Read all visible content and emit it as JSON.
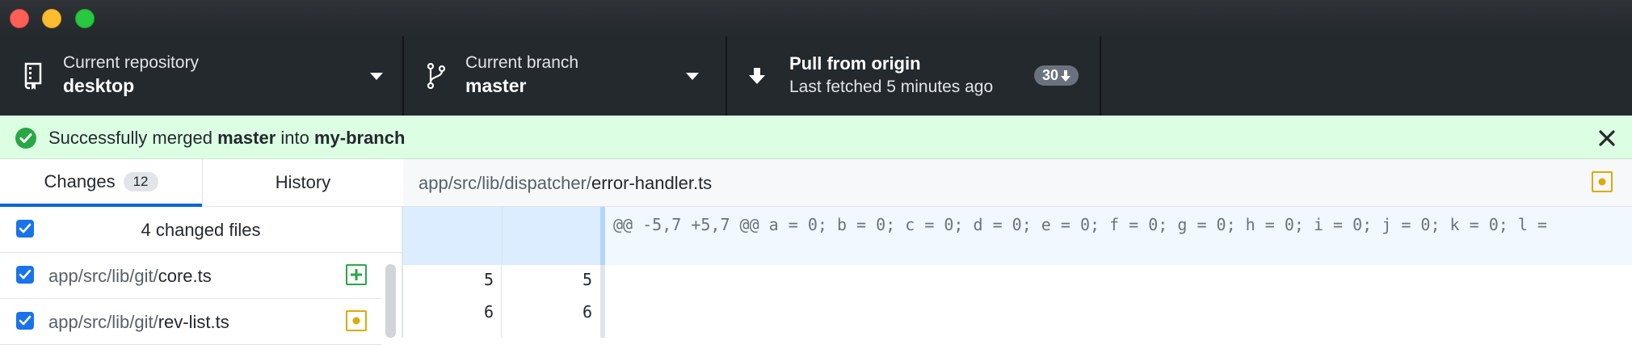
{
  "window": {
    "buttons": [
      "close",
      "minimize",
      "maximize"
    ]
  },
  "toolbar": {
    "repository": {
      "label": "Current repository",
      "value": "desktop",
      "icon": "repo-icon"
    },
    "branch": {
      "label": "Current branch",
      "value": "master",
      "icon": "git-branch-icon"
    },
    "pull": {
      "title": "Pull from origin",
      "subtitle": "Last fetched 5 minutes ago",
      "count": "30",
      "icon": "arrow-down-icon"
    }
  },
  "banner": {
    "prefix": "Successfully merged ",
    "source": "master",
    "middle": " into ",
    "target": "my-branch",
    "icon": "check-circle-icon"
  },
  "sidebar": {
    "tabs": [
      {
        "label": "Changes",
        "count": "12",
        "selected": true
      },
      {
        "label": "History",
        "selected": false
      }
    ],
    "header": "4 changed files",
    "files": [
      {
        "dir": "app/src/lib/git/",
        "name": "core.ts",
        "status": "added"
      },
      {
        "dir": "app/src/lib/git/",
        "name": "rev-list.ts",
        "status": "modified"
      }
    ]
  },
  "diff": {
    "path_dir": "app/src/lib/dispatcher/",
    "path_file": "error-handler.ts",
    "file_status": "modified",
    "hunk_header": "@@ -5,7 +5,7 @@ a = 0; b = 0; c = 0; d = 0; e = 0; f = 0; g = 0; h = 0; i = 0; j = 0; k = 0; l =",
    "lines": [
      {
        "old": "5",
        "new": "5"
      },
      {
        "old": "6",
        "new": "6"
      }
    ]
  },
  "colors": {
    "accent": "#0366d6",
    "added": "#28a745",
    "modified": "#dbab09",
    "banner_bg": "#dcffe4",
    "toolbar_bg": "#24292e"
  }
}
